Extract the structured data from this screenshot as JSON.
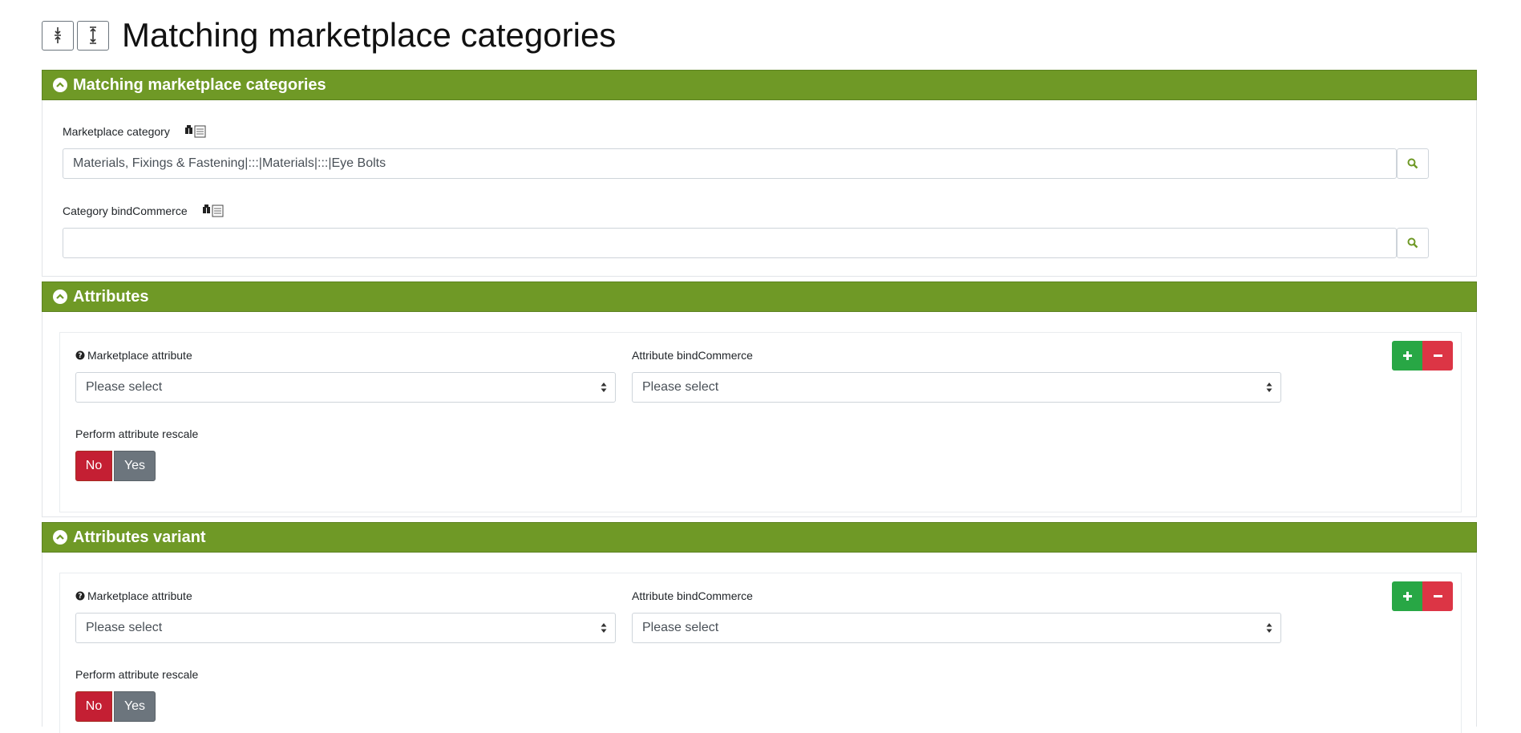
{
  "page": {
    "title": "Matching marketplace categories"
  },
  "toolbar": {
    "collapse_icon": "collapse-all-icon",
    "expand_icon": "expand-all-icon"
  },
  "matching": {
    "header": "Matching marketplace categories",
    "marketplace_category_label": "Marketplace category",
    "marketplace_category_value": "Materials, Fixings & Fastening|:::|Materials|:::|Eye Bolts",
    "bind_category_label": "Category bindCommerce",
    "bind_category_value": ""
  },
  "attributes": {
    "header": "Attributes",
    "marketplace_attribute_label": "Marketplace attribute",
    "marketplace_attribute_value": "Please select",
    "bind_attribute_label": "Attribute bindCommerce",
    "bind_attribute_value": "Please select",
    "rescale_label": "Perform attribute rescale",
    "no_label": "No",
    "yes_label": "Yes"
  },
  "attributes_variant": {
    "header": "Attributes variant",
    "marketplace_attribute_label": "Marketplace attribute",
    "marketplace_attribute_value": "Please select",
    "bind_attribute_label": "Attribute bindCommerce",
    "bind_attribute_value": "Please select",
    "rescale_label": "Perform attribute rescale",
    "no_label": "No",
    "yes_label": "Yes"
  },
  "colors": {
    "header_green": "#6f9926",
    "plus_green": "#28a745",
    "minus_red": "#dc3545",
    "no_red": "#c41f33",
    "yes_gray": "#6c757d"
  }
}
